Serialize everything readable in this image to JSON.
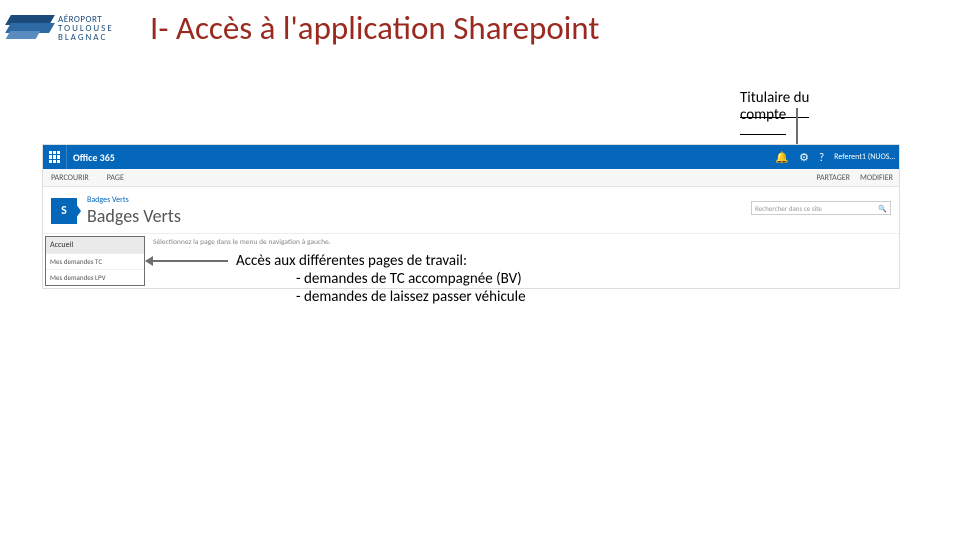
{
  "header": {
    "logo": {
      "line1": "AÉROPORT",
      "line2": "TOULOUSE",
      "line3": "BLAGNAC"
    },
    "title": "I- Accès à l'application Sharepoint"
  },
  "callouts": {
    "account": "Titulaire du compte",
    "pages": {
      "title": "Accès aux différentes pages de travail:",
      "bv": "- demandes de TC accompagnée (BV)",
      "lpv": "- demandes  de laissez passer véhicule"
    }
  },
  "o365": {
    "brand": "Office 365",
    "notification_icon": "🔔",
    "settings_icon": "⚙",
    "help_icon": "?",
    "user": "Referent1 (NUOS…"
  },
  "ribbon": {
    "tab1": "PARCOURIR",
    "tab2": "PAGE",
    "share": "PARTAGER",
    "edit": "MODIFIER"
  },
  "site": {
    "tile_letter": "S",
    "breadcrumb": "Badges Verts",
    "title": "Badges Verts",
    "search_placeholder": "Rechercher dans ce site",
    "search_icon": "🔍"
  },
  "leftnav": {
    "head": "Accueil",
    "item1": "Mes demandes TC",
    "item2": "Mes demandes LPV"
  },
  "main": {
    "hint": "Sélectionnez la page dans le menu de navigation à gauche."
  }
}
